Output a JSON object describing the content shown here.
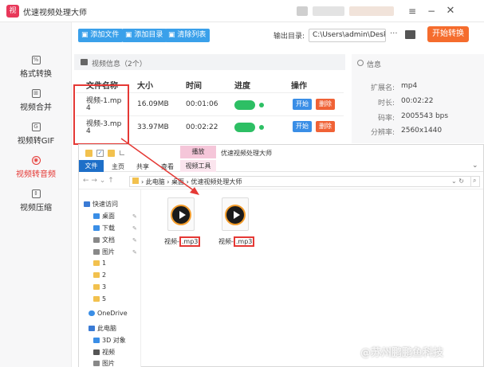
{
  "app": {
    "title": "优速视频处理大师",
    "logo_glyph": "视"
  },
  "window": {
    "menu_icon": "menu-icon",
    "min_icon": "minimize-icon",
    "close_icon": "close-icon"
  },
  "sidebar": {
    "items": [
      {
        "label": "格式转换",
        "icon": "%",
        "active": false
      },
      {
        "label": "视频合并",
        "icon": "⊞",
        "active": false
      },
      {
        "label": "视频转GIF",
        "icon": "G",
        "active": false
      },
      {
        "label": "视频转音频",
        "icon": "◉",
        "active": true
      },
      {
        "label": "视频压缩",
        "icon": "⇕",
        "active": false
      }
    ]
  },
  "toolbar": {
    "add_file": "添加文件",
    "add_dir": "添加目录",
    "clear_list": "清除列表",
    "output_label": "输出目录:",
    "output_path": "C:\\Users\\admin\\Deskto",
    "start_all": "开始转换"
  },
  "video_info": {
    "header": "视频信息（2个）",
    "columns": [
      "文件名称",
      "大小",
      "时间",
      "进度",
      "操作"
    ],
    "rows": [
      {
        "name_line1": "视频-1.mp",
        "name_line2": "4",
        "size": "16.09MB",
        "time": "00:01:06",
        "start": "开始",
        "delete": "删除"
      },
      {
        "name_line1": "视频-3.mp",
        "name_line2": "4",
        "size": "33.97MB",
        "time": "00:02:22",
        "start": "开始",
        "delete": "删除"
      }
    ]
  },
  "detail": {
    "header": "信息",
    "rows": [
      {
        "key": "扩展名:",
        "value": "mp4"
      },
      {
        "key": "时长:",
        "value": "00:02:22"
      },
      {
        "key": "码率:",
        "value": "2005543 bps"
      },
      {
        "key": "分辨率:",
        "value": "2560x1440"
      }
    ]
  },
  "explorer": {
    "context_tab": "播放",
    "window_title": "优速视频处理大师",
    "ribbon_tabs": [
      "文件",
      "主页",
      "共享",
      "查看",
      "视频工具"
    ],
    "breadcrumb": [
      "此电脑",
      "桌面",
      "优速视频处理大师"
    ],
    "nav": [
      {
        "label": "快速访问",
        "color": "#3a7bd5",
        "indent": 0
      },
      {
        "label": "桌面",
        "color": "#3a8ee6",
        "indent": 1
      },
      {
        "label": "下载",
        "color": "#3a8ee6",
        "indent": 1
      },
      {
        "label": "文档",
        "color": "#888",
        "indent": 1
      },
      {
        "label": "图片",
        "color": "#888",
        "indent": 1
      },
      {
        "label": "1",
        "color": "#f2c14e",
        "indent": 1
      },
      {
        "label": "2",
        "color": "#f2c14e",
        "indent": 1
      },
      {
        "label": "3",
        "color": "#f2c14e",
        "indent": 1
      },
      {
        "label": "5",
        "color": "#f2c14e",
        "indent": 1
      },
      {
        "label": "OneDrive",
        "color": "#3a8ee6",
        "indent": 0
      },
      {
        "label": "此电脑",
        "color": "#3a7bd5",
        "indent": 0
      },
      {
        "label": "3D 对象",
        "color": "#3a8ee6",
        "indent": 1
      },
      {
        "label": "视频",
        "color": "#555",
        "indent": 1
      },
      {
        "label": "图片",
        "color": "#888",
        "indent": 1
      }
    ],
    "files": [
      {
        "prefix": "视频-",
        "ext": ".mp3"
      },
      {
        "prefix": "视频-",
        "ext": ".mp3"
      }
    ]
  },
  "watermark": "@苏州鹏鹏鱼科技",
  "colors": {
    "accent": "#3aa0ea",
    "start_all": "#f56c2d",
    "active_nav": "#e53935",
    "highlight": "#e53935",
    "progress": "#2dbf64"
  }
}
